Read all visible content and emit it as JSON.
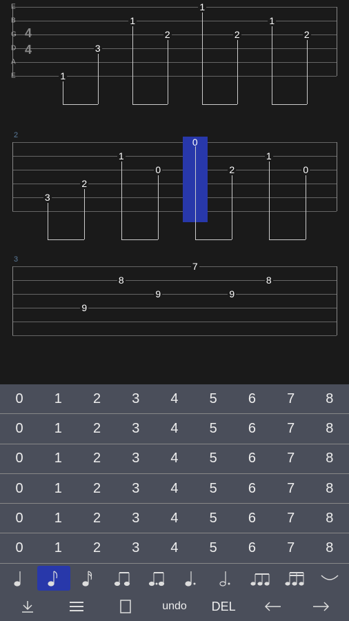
{
  "strings": [
    "E",
    "B",
    "G",
    "D",
    "A",
    "E"
  ],
  "time_signature": {
    "top": "4",
    "bottom": "4"
  },
  "measures": [
    {
      "number": "",
      "show_labels": true,
      "show_timesig": true,
      "cursor": null,
      "notes": [
        {
          "pos": 0,
          "string": 5,
          "fret": "1"
        },
        {
          "pos": 1,
          "string": 3,
          "fret": "3"
        },
        {
          "pos": 2,
          "string": 1,
          "fret": "1"
        },
        {
          "pos": 3,
          "string": 2,
          "fret": "2"
        },
        {
          "pos": 4,
          "string": 0,
          "fret": "1"
        },
        {
          "pos": 5,
          "string": 2,
          "fret": "2"
        },
        {
          "pos": 6,
          "string": 1,
          "fret": "1"
        },
        {
          "pos": 7,
          "string": 2,
          "fret": "2"
        }
      ],
      "beams": [
        [
          0,
          1
        ],
        [
          2,
          3
        ],
        [
          4,
          5
        ],
        [
          6,
          7
        ]
      ]
    },
    {
      "number": "2",
      "cursor": 4,
      "notes": [
        {
          "pos": 0,
          "string": 4,
          "fret": "3"
        },
        {
          "pos": 1,
          "string": 3,
          "fret": "2"
        },
        {
          "pos": 2,
          "string": 1,
          "fret": "1"
        },
        {
          "pos": 3,
          "string": 2,
          "fret": "0"
        },
        {
          "pos": 4,
          "string": 0,
          "fret": "0"
        },
        {
          "pos": 5,
          "string": 2,
          "fret": "2"
        },
        {
          "pos": 6,
          "string": 1,
          "fret": "1"
        },
        {
          "pos": 7,
          "string": 2,
          "fret": "0"
        }
      ],
      "beams": [
        [
          0,
          1
        ],
        [
          2,
          3
        ],
        [
          4,
          5
        ],
        [
          6,
          7
        ]
      ]
    },
    {
      "number": "3",
      "cursor": null,
      "partial": true,
      "notes": [
        {
          "pos": 0,
          "string": 4,
          "fret": ""
        },
        {
          "pos": 1,
          "string": 3,
          "fret": "9"
        },
        {
          "pos": 2,
          "string": 1,
          "fret": "8"
        },
        {
          "pos": 3,
          "string": 2,
          "fret": "9"
        },
        {
          "pos": 4,
          "string": 0,
          "fret": "7"
        },
        {
          "pos": 5,
          "string": 2,
          "fret": "9"
        },
        {
          "pos": 6,
          "string": 1,
          "fret": "8"
        },
        {
          "pos": 7,
          "string": 2,
          "fret": ""
        }
      ],
      "beams": []
    }
  ],
  "keyboard": {
    "rows": [
      [
        "0",
        "1",
        "2",
        "3",
        "4",
        "5",
        "6",
        "7",
        "8"
      ],
      [
        "0",
        "1",
        "2",
        "3",
        "4",
        "5",
        "6",
        "7",
        "8"
      ],
      [
        "0",
        "1",
        "2",
        "3",
        "4",
        "5",
        "6",
        "7",
        "8"
      ],
      [
        "0",
        "1",
        "2",
        "3",
        "4",
        "5",
        "6",
        "7",
        "8"
      ],
      [
        "0",
        "1",
        "2",
        "3",
        "4",
        "5",
        "6",
        "7",
        "8"
      ],
      [
        "0",
        "1",
        "2",
        "3",
        "4",
        "5",
        "6",
        "7",
        "8"
      ]
    ],
    "durations": [
      "quarter",
      "eighth",
      "sixteenth",
      "eighth-pair",
      "eighth-dotted",
      "quarter-dotted",
      "half-dotted",
      "triplet",
      "triplet16",
      "tie"
    ],
    "selected_duration": 1,
    "controls": {
      "undo_label": "undo",
      "del_label": "DEL"
    }
  }
}
